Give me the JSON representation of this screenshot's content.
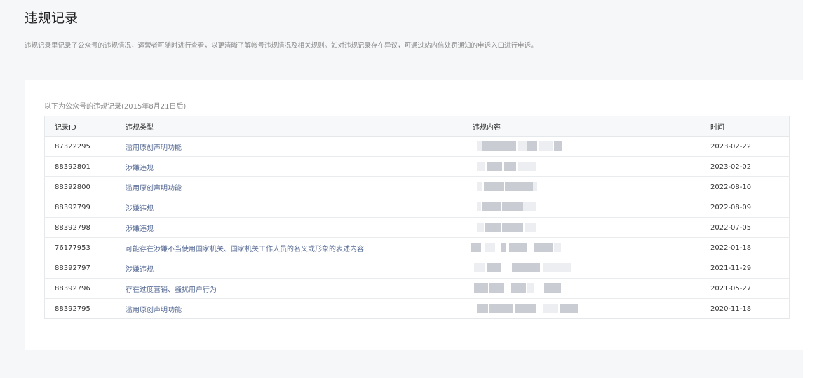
{
  "header": {
    "title": "违规记录",
    "description": "违规记录里记录了公众号的违规情况，运营者可随时进行查看，以更清晰了解帐号违规情况及相关规则。如对违规记录存在异议，可通过站内信处罚通知的申诉入口进行申诉。"
  },
  "table": {
    "caption": "以下为公众号的违规记录(2015年8月21日后)",
    "columns": [
      "记录ID",
      "违规类型",
      "违规内容",
      "时间"
    ],
    "rows": [
      {
        "id": "87322295",
        "type": "滥用原创声明功能",
        "content": "",
        "time": "2023-02-22"
      },
      {
        "id": "88392801",
        "type": "涉嫌违规",
        "content": "",
        "time": "2023-02-02"
      },
      {
        "id": "88392800",
        "type": "滥用原创声明功能",
        "content": "",
        "time": "2022-08-10"
      },
      {
        "id": "88392799",
        "type": "涉嫌违规",
        "content": "",
        "time": "2022-08-09"
      },
      {
        "id": "88392798",
        "type": "涉嫌违规",
        "content": "",
        "time": "2022-07-05"
      },
      {
        "id": "76177953",
        "type": "可能存在涉嫌不当使用国家机关、国家机关工作人员的名义或形象的表述内容",
        "content": "",
        "time": "2022-01-18"
      },
      {
        "id": "88392797",
        "type": "涉嫌违规",
        "content": "",
        "time": "2021-11-29"
      },
      {
        "id": "88392796",
        "type": "存在过度营销、骚扰用户行为",
        "content": "",
        "time": "2021-05-27"
      },
      {
        "id": "88392795",
        "type": "滥用原创声明功能",
        "content": "",
        "time": "2020-11-18"
      }
    ]
  }
}
